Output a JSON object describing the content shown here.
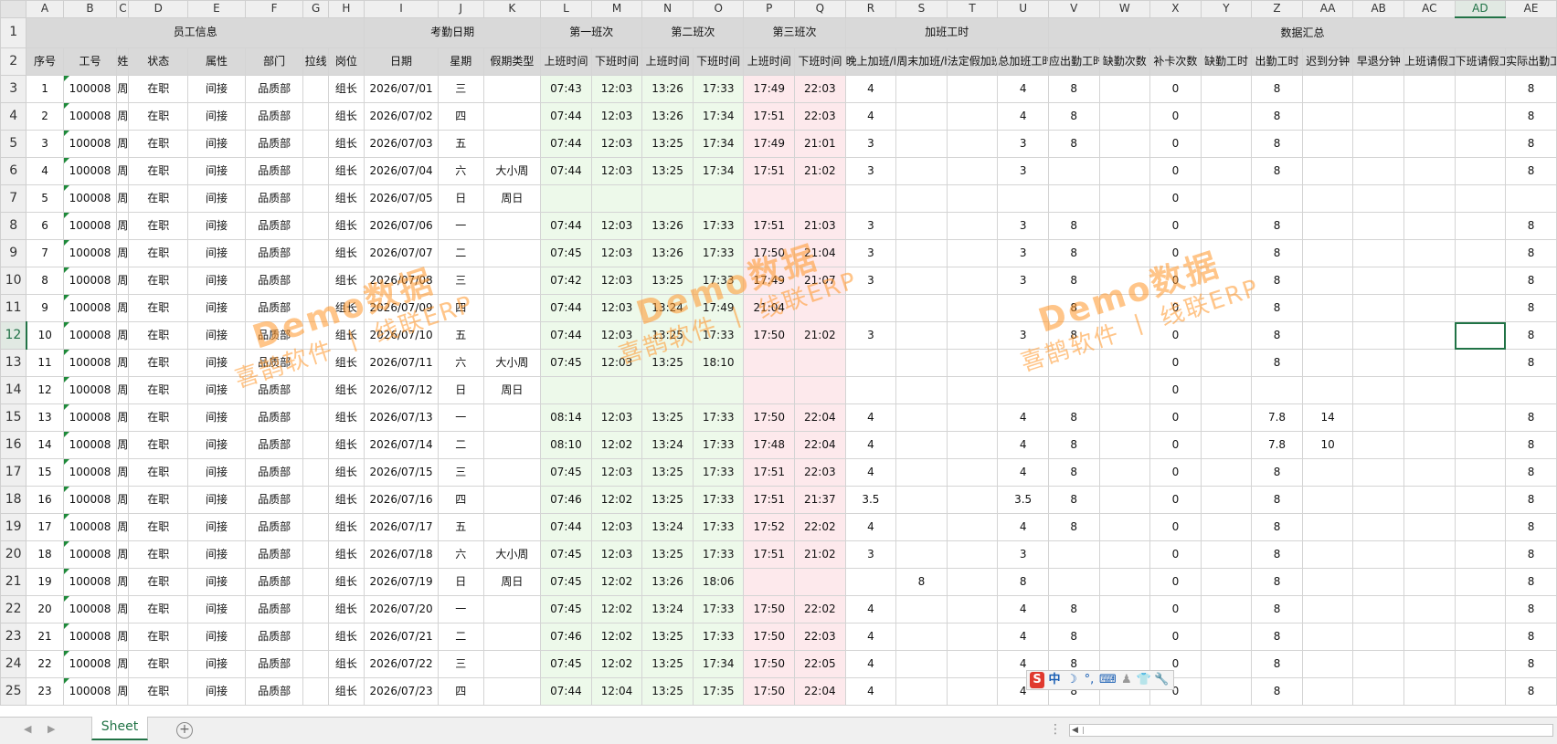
{
  "columns": [
    {
      "letter": "A",
      "w": 40
    },
    {
      "letter": "B",
      "w": 58
    },
    {
      "letter": "C",
      "w": 13
    },
    {
      "letter": "D",
      "w": 64
    },
    {
      "letter": "E",
      "w": 62
    },
    {
      "letter": "F",
      "w": 63
    },
    {
      "letter": "G",
      "w": 27
    },
    {
      "letter": "H",
      "w": 39
    },
    {
      "letter": "I",
      "w": 80
    },
    {
      "letter": "J",
      "w": 49
    },
    {
      "letter": "K",
      "w": 62
    },
    {
      "letter": "L",
      "w": 55
    },
    {
      "letter": "M",
      "w": 55
    },
    {
      "letter": "N",
      "w": 55
    },
    {
      "letter": "O",
      "w": 55
    },
    {
      "letter": "P",
      "w": 55
    },
    {
      "letter": "Q",
      "w": 55
    },
    {
      "letter": "R",
      "w": 55
    },
    {
      "letter": "S",
      "w": 55
    },
    {
      "letter": "T",
      "w": 55
    },
    {
      "letter": "U",
      "w": 55
    },
    {
      "letter": "V",
      "w": 55
    },
    {
      "letter": "W",
      "w": 55
    },
    {
      "letter": "X",
      "w": 55
    },
    {
      "letter": "Y",
      "w": 55
    },
    {
      "letter": "Z",
      "w": 55
    },
    {
      "letter": "AA",
      "w": 55
    },
    {
      "letter": "AB",
      "w": 55
    },
    {
      "letter": "AC",
      "w": 55
    },
    {
      "letter": "AD",
      "w": 55
    },
    {
      "letter": "AE",
      "w": 55
    }
  ],
  "selected_column": "AD",
  "selected_row": 12,
  "header_row1": [
    {
      "text": "员工信息",
      "span": 8
    },
    {
      "text": "考勤日期",
      "span": 3
    },
    {
      "text": "第一班次",
      "span": 2,
      "tint": "green"
    },
    {
      "text": "第二班次",
      "span": 2,
      "tint": "green"
    },
    {
      "text": "第三班次",
      "span": 2,
      "tint": "pink"
    },
    {
      "text": "加班工时",
      "span": 4
    },
    {
      "text": "数据汇总",
      "span": 10
    }
  ],
  "header_row2": [
    "序号",
    "工号",
    "姓名",
    "状态",
    "属性",
    "部门",
    "拉线",
    "岗位",
    "日期",
    "星期",
    "假期类型",
    "上班时间",
    "下班时间",
    "上班时间",
    "下班时间",
    "上班时间",
    "下班时间",
    "晚上加班/h",
    "周末加班/h",
    "法定假加班",
    "总加班工时",
    "应出勤工时",
    "缺勤次数",
    "补卡次数",
    "缺勤工时",
    "出勤工时",
    "迟到分钟",
    "早退分钟",
    "上班请假工时",
    "下班请假工时",
    "实际出勤工时"
  ],
  "rows": [
    [
      "1",
      "100008",
      "周",
      "在职",
      "间接",
      "品质部",
      "",
      "组长",
      "2026/07/01",
      "三",
      "",
      "07:43",
      "12:03",
      "13:26",
      "17:33",
      "17:49",
      "22:03",
      "4",
      "",
      "",
      "4",
      "8",
      "",
      "0",
      "",
      "8",
      "",
      "",
      "",
      "",
      "8"
    ],
    [
      "2",
      "100008",
      "周",
      "在职",
      "间接",
      "品质部",
      "",
      "组长",
      "2026/07/02",
      "四",
      "",
      "07:44",
      "12:03",
      "13:26",
      "17:34",
      "17:51",
      "22:03",
      "4",
      "",
      "",
      "4",
      "8",
      "",
      "0",
      "",
      "8",
      "",
      "",
      "",
      "",
      "8"
    ],
    [
      "3",
      "100008",
      "周",
      "在职",
      "间接",
      "品质部",
      "",
      "组长",
      "2026/07/03",
      "五",
      "",
      "07:44",
      "12:03",
      "13:25",
      "17:34",
      "17:49",
      "21:01",
      "3",
      "",
      "",
      "3",
      "8",
      "",
      "0",
      "",
      "8",
      "",
      "",
      "",
      "",
      "8"
    ],
    [
      "4",
      "100008",
      "周",
      "在职",
      "间接",
      "品质部",
      "",
      "组长",
      "2026/07/04",
      "六",
      "大小周",
      "07:44",
      "12:03",
      "13:25",
      "17:34",
      "17:51",
      "21:02",
      "3",
      "",
      "",
      "3",
      "",
      "",
      "0",
      "",
      "8",
      "",
      "",
      "",
      "",
      "8"
    ],
    [
      "5",
      "100008",
      "周",
      "在职",
      "间接",
      "品质部",
      "",
      "组长",
      "2026/07/05",
      "日",
      "周日",
      "",
      "",
      "",
      "",
      "",
      "",
      "",
      "",
      "",
      "",
      "",
      "",
      "0",
      "",
      "",
      "",
      "",
      "",
      "",
      ""
    ],
    [
      "6",
      "100008",
      "周",
      "在职",
      "间接",
      "品质部",
      "",
      "组长",
      "2026/07/06",
      "一",
      "",
      "07:44",
      "12:03",
      "13:26",
      "17:33",
      "17:51",
      "21:03",
      "3",
      "",
      "",
      "3",
      "8",
      "",
      "0",
      "",
      "8",
      "",
      "",
      "",
      "",
      "8"
    ],
    [
      "7",
      "100008",
      "周",
      "在职",
      "间接",
      "品质部",
      "",
      "组长",
      "2026/07/07",
      "二",
      "",
      "07:45",
      "12:03",
      "13:26",
      "17:33",
      "17:50",
      "21:04",
      "3",
      "",
      "",
      "3",
      "8",
      "",
      "0",
      "",
      "8",
      "",
      "",
      "",
      "",
      "8"
    ],
    [
      "8",
      "100008",
      "周",
      "在职",
      "间接",
      "品质部",
      "",
      "组长",
      "2026/07/08",
      "三",
      "",
      "07:42",
      "12:03",
      "13:25",
      "17:33",
      "17:49",
      "21:07",
      "3",
      "",
      "",
      "3",
      "8",
      "",
      "0",
      "",
      "8",
      "",
      "",
      "",
      "",
      "8"
    ],
    [
      "9",
      "100008",
      "周",
      "在职",
      "间接",
      "品质部",
      "",
      "组长",
      "2026/07/09",
      "四",
      "",
      "07:44",
      "12:03",
      "13:24",
      "17:49",
      "21:04",
      "",
      "",
      "",
      "",
      "",
      "8",
      "",
      "0",
      "",
      "8",
      "",
      "",
      "",
      "",
      "8"
    ],
    [
      "10",
      "100008",
      "周",
      "在职",
      "间接",
      "品质部",
      "",
      "组长",
      "2026/07/10",
      "五",
      "",
      "07:44",
      "12:03",
      "13:25",
      "17:33",
      "17:50",
      "21:02",
      "3",
      "",
      "",
      "3",
      "8",
      "",
      "0",
      "",
      "8",
      "",
      "",
      "",
      "",
      "8"
    ],
    [
      "11",
      "100008",
      "周",
      "在职",
      "间接",
      "品质部",
      "",
      "组长",
      "2026/07/11",
      "六",
      "大小周",
      "07:45",
      "12:03",
      "13:25",
      "18:10",
      "",
      "",
      "",
      "",
      "",
      "",
      "",
      "",
      "0",
      "",
      "8",
      "",
      "",
      "",
      "",
      "8"
    ],
    [
      "12",
      "100008",
      "周",
      "在职",
      "间接",
      "品质部",
      "",
      "组长",
      "2026/07/12",
      "日",
      "周日",
      "",
      "",
      "",
      "",
      "",
      "",
      "",
      "",
      "",
      "",
      "",
      "",
      "0",
      "",
      "",
      "",
      "",
      "",
      "",
      ""
    ],
    [
      "13",
      "100008",
      "周",
      "在职",
      "间接",
      "品质部",
      "",
      "组长",
      "2026/07/13",
      "一",
      "",
      "08:14",
      "12:03",
      "13:25",
      "17:33",
      "17:50",
      "22:04",
      "4",
      "",
      "",
      "4",
      "8",
      "",
      "0",
      "",
      "7.8",
      "14",
      "",
      "",
      "",
      "8"
    ],
    [
      "14",
      "100008",
      "周",
      "在职",
      "间接",
      "品质部",
      "",
      "组长",
      "2026/07/14",
      "二",
      "",
      "08:10",
      "12:02",
      "13:24",
      "17:33",
      "17:48",
      "22:04",
      "4",
      "",
      "",
      "4",
      "8",
      "",
      "0",
      "",
      "7.8",
      "10",
      "",
      "",
      "",
      "8"
    ],
    [
      "15",
      "100008",
      "周",
      "在职",
      "间接",
      "品质部",
      "",
      "组长",
      "2026/07/15",
      "三",
      "",
      "07:45",
      "12:03",
      "13:25",
      "17:33",
      "17:51",
      "22:03",
      "4",
      "",
      "",
      "4",
      "8",
      "",
      "0",
      "",
      "8",
      "",
      "",
      "",
      "",
      "8"
    ],
    [
      "16",
      "100008",
      "周",
      "在职",
      "间接",
      "品质部",
      "",
      "组长",
      "2026/07/16",
      "四",
      "",
      "07:46",
      "12:02",
      "13:25",
      "17:33",
      "17:51",
      "21:37",
      "3.5",
      "",
      "",
      "3.5",
      "8",
      "",
      "0",
      "",
      "8",
      "",
      "",
      "",
      "",
      "8"
    ],
    [
      "17",
      "100008",
      "周",
      "在职",
      "间接",
      "品质部",
      "",
      "组长",
      "2026/07/17",
      "五",
      "",
      "07:44",
      "12:03",
      "13:24",
      "17:33",
      "17:52",
      "22:02",
      "4",
      "",
      "",
      "4",
      "8",
      "",
      "0",
      "",
      "8",
      "",
      "",
      "",
      "",
      "8"
    ],
    [
      "18",
      "100008",
      "周",
      "在职",
      "间接",
      "品质部",
      "",
      "组长",
      "2026/07/18",
      "六",
      "大小周",
      "07:45",
      "12:03",
      "13:25",
      "17:33",
      "17:51",
      "21:02",
      "3",
      "",
      "",
      "3",
      "",
      "",
      "0",
      "",
      "8",
      "",
      "",
      "",
      "",
      "8"
    ],
    [
      "19",
      "100008",
      "周",
      "在职",
      "间接",
      "品质部",
      "",
      "组长",
      "2026/07/19",
      "日",
      "周日",
      "07:45",
      "12:02",
      "13:26",
      "18:06",
      "",
      "",
      "",
      "8",
      "",
      "8",
      "",
      "",
      "0",
      "",
      "8",
      "",
      "",
      "",
      "",
      "8"
    ],
    [
      "20",
      "100008",
      "周",
      "在职",
      "间接",
      "品质部",
      "",
      "组长",
      "2026/07/20",
      "一",
      "",
      "07:45",
      "12:02",
      "13:24",
      "17:33",
      "17:50",
      "22:02",
      "4",
      "",
      "",
      "4",
      "8",
      "",
      "0",
      "",
      "8",
      "",
      "",
      "",
      "",
      "8"
    ],
    [
      "21",
      "100008",
      "周",
      "在职",
      "间接",
      "品质部",
      "",
      "组长",
      "2026/07/21",
      "二",
      "",
      "07:46",
      "12:02",
      "13:25",
      "17:33",
      "17:50",
      "22:03",
      "4",
      "",
      "",
      "4",
      "8",
      "",
      "0",
      "",
      "8",
      "",
      "",
      "",
      "",
      "8"
    ],
    [
      "22",
      "100008",
      "周",
      "在职",
      "间接",
      "品质部",
      "",
      "组长",
      "2026/07/22",
      "三",
      "",
      "07:45",
      "12:02",
      "13:25",
      "17:34",
      "17:50",
      "22:05",
      "4",
      "",
      "",
      "4",
      "8",
      "",
      "0",
      "",
      "8",
      "",
      "",
      "",
      "",
      "8"
    ],
    [
      "23",
      "100008",
      "周",
      "在职",
      "间接",
      "品质部",
      "",
      "组长",
      "2026/07/23",
      "四",
      "",
      "07:44",
      "12:04",
      "13:25",
      "17:35",
      "17:50",
      "22:04",
      "4",
      "",
      "",
      "4",
      "8",
      "",
      "0",
      "",
      "8",
      "",
      "",
      "",
      "",
      "8"
    ]
  ],
  "watermarks": [
    {
      "line1": "Demo数据",
      "line2": "喜鹊软件 丨 线联ERP"
    },
    {
      "line1": "Demo数据",
      "line2": "喜鹊软件 丨 线联ERP"
    },
    {
      "line1": "Demo数据",
      "line2": "喜鹊软件 丨 线联ERP"
    }
  ],
  "sheet_tab": "Sheet",
  "add_sheet_icon": "plus-circle-icon",
  "ime_toolbar": {
    "logo": "S",
    "lang": "中",
    "items": [
      "moon-icon",
      "punctuation-icon",
      "keyboard-icon",
      "user-icon",
      "shirt-icon",
      "wrench-icon"
    ]
  },
  "colors": {
    "accent": "#217346",
    "holiday": "#e26b0a",
    "green_tint": "#edf9ea",
    "pink_tint": "#fde9ec",
    "header_fill": "#d9d9d9",
    "watermark": "#ff9628"
  }
}
